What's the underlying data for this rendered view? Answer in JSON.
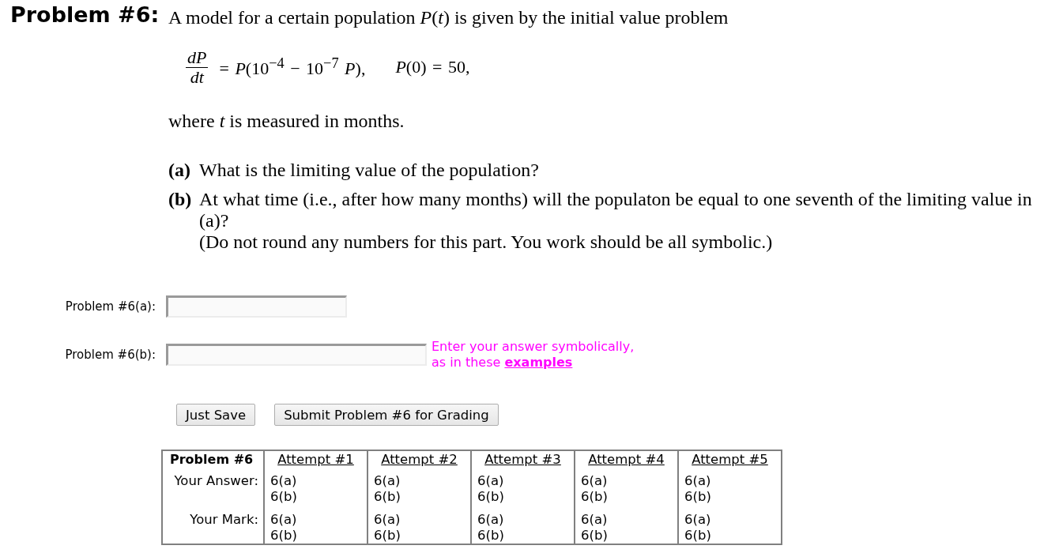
{
  "problem": {
    "title": "Problem #6:",
    "intro": "A model for a certain population *P*(*t*) is given by the initial value problem",
    "equation": {
      "numerator": "dP",
      "denominator": "dt",
      "rhs": "= *P*(10$^{−4}$ − 10$^{−7}$ *P*),",
      "initial": "*P*(0) = 50,"
    },
    "note": "where *t* is measured in months.",
    "parts": [
      {
        "label": "(a)",
        "lines": [
          "What is the limiting value of the population?"
        ]
      },
      {
        "label": "(b)",
        "lines": [
          "At what time (i.e., after how many months) will the populaton be equal to one seventh of the limiting value in (a)?",
          "(Do not round any numbers for this part. You work should be all symbolic.)"
        ]
      }
    ]
  },
  "answers": [
    {
      "label": "Problem #6(a):"
    },
    {
      "label": "Problem #6(b):",
      "hint": {
        "text": "Enter your answer symbolically, as in these",
        "link": "examples"
      }
    }
  ],
  "buttons": [
    "Just Save",
    "Submit Problem #6 for Grading"
  ],
  "attempts_table": {
    "header": "Problem #6",
    "columns": [
      "Attempt #1",
      "Attempt #2",
      "Attempt #3",
      "Attempt #4",
      "Attempt #5"
    ],
    "rows": [
      {
        "label": "Your Answer:",
        "cells": [
          [
            "6(a)",
            "6(b)"
          ],
          [
            "6(a)",
            "6(b)"
          ],
          [
            "6(a)",
            "6(b)"
          ],
          [
            "6(a)",
            "6(b)"
          ],
          [
            "6(a)",
            "6(b)"
          ]
        ]
      },
      {
        "label": "Your Mark:",
        "cells": [
          [
            "6(a)",
            "6(b)"
          ],
          [
            "6(a)",
            "6(b)"
          ],
          [
            "6(a)",
            "6(b)"
          ],
          [
            "6(a)",
            "6(b)"
          ],
          [
            "6(a)",
            "6(b)"
          ]
        ]
      }
    ]
  }
}
